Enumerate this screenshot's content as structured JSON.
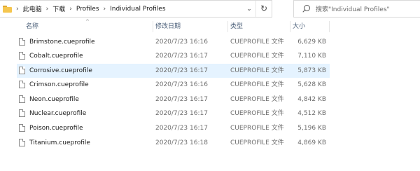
{
  "address_bar": {
    "breadcrumb": [
      "此电脑",
      "下载",
      "Profiles",
      "Individual Profiles"
    ],
    "dropdown_icon": "chevron-down-icon",
    "refresh_icon": "refresh-icon"
  },
  "search": {
    "placeholder": "搜索\"Individual Profiles\""
  },
  "columns": {
    "name": "名称",
    "date": "修改日期",
    "type": "类型",
    "size": "大小"
  },
  "files": [
    {
      "name": "Brimstone.cueprofile",
      "date": "2020/7/23 16:16",
      "type": "CUEPROFILE 文件",
      "size": "6,629 KB"
    },
    {
      "name": "Cobalt.cueprofile",
      "date": "2020/7/23 16:17",
      "type": "CUEPROFILE 文件",
      "size": "7,110 KB"
    },
    {
      "name": "Corrosive.cueprofile",
      "date": "2020/7/23 16:17",
      "type": "CUEPROFILE 文件",
      "size": "5,873 KB",
      "selected": true
    },
    {
      "name": "Crimson.cueprofile",
      "date": "2020/7/23 16:16",
      "type": "CUEPROFILE 文件",
      "size": "5,628 KB"
    },
    {
      "name": "Neon.cueprofile",
      "date": "2020/7/23 16:17",
      "type": "CUEPROFILE 文件",
      "size": "4,842 KB"
    },
    {
      "name": "Nuclear.cueprofile",
      "date": "2020/7/23 16:17",
      "type": "CUEPROFILE 文件",
      "size": "4,512 KB"
    },
    {
      "name": "Poison.cueprofile",
      "date": "2020/7/23 16:17",
      "type": "CUEPROFILE 文件",
      "size": "5,196 KB"
    },
    {
      "name": "Titanium.cueprofile",
      "date": "2020/7/23 16:18",
      "type": "CUEPROFILE 文件",
      "size": "4,869 KB"
    }
  ],
  "colors": {
    "selection": "#e5f3ff",
    "header_text": "#4c607a",
    "folder": "#f5c64f"
  }
}
